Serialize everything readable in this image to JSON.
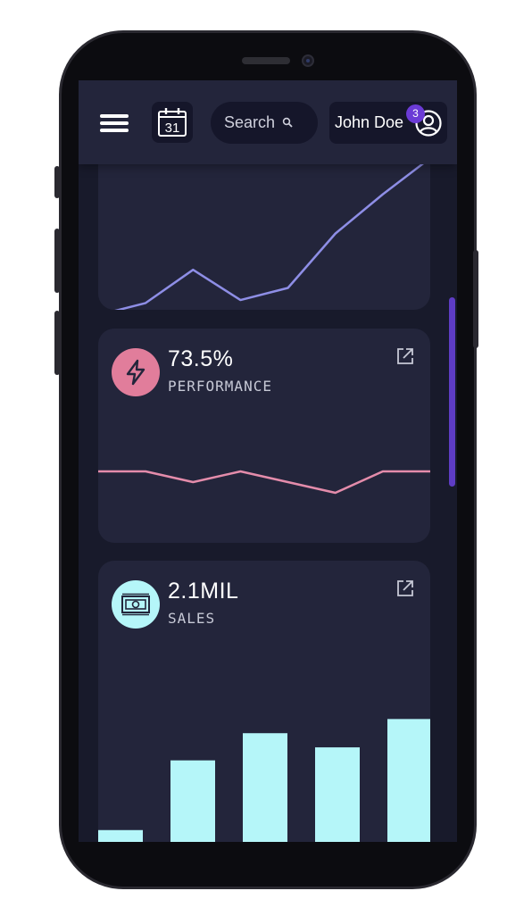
{
  "header": {
    "calendar_day": "31",
    "search_placeholder": "Search",
    "user_name": "John Doe",
    "notification_count": "3"
  },
  "cards": [
    {
      "icon": "trend-icon"
    },
    {
      "value": "73.5%",
      "label": "PERFORMANCE",
      "icon": "lightning-icon",
      "icon_bg": "#e17d9b",
      "accent": "#e48cab"
    },
    {
      "value": "2.1MIL",
      "label": "SALES",
      "icon": "cash-icon",
      "icon_bg": "#b5f6f9",
      "accent": "#b5f6f9"
    }
  ],
  "colors": {
    "screen_bg": "#181a2b",
    "card_bg": "#23253b",
    "topbar_bg": "#23253b",
    "line_primary": "#8e8ee6",
    "line_performance": "#e48cab",
    "bars": "#b5f6f9",
    "scrollbar": "#5e3cc4",
    "badge": "#6b3bd6"
  },
  "chart_data": [
    {
      "type": "line",
      "x": [
        0,
        1,
        2,
        3,
        4,
        5,
        6,
        7
      ],
      "series": [
        {
          "values": [
            8,
            12,
            23,
            13,
            17,
            35,
            48,
            60
          ]
        }
      ],
      "ylim": [
        0,
        68
      ],
      "grid": false
    },
    {
      "type": "line",
      "x": [
        0,
        1,
        2,
        3,
        4,
        5,
        6,
        7
      ],
      "series": [
        {
          "values": [
            20,
            20,
            14,
            20,
            14,
            8,
            20,
            20
          ]
        }
      ],
      "ylim": [
        0,
        40
      ],
      "grid": false
    },
    {
      "type": "bar",
      "categories": [
        "1",
        "2",
        "3",
        "4",
        "5"
      ],
      "values": [
        10,
        69,
        92,
        80,
        104
      ],
      "ylim": [
        0,
        170
      ],
      "grid": false
    }
  ]
}
